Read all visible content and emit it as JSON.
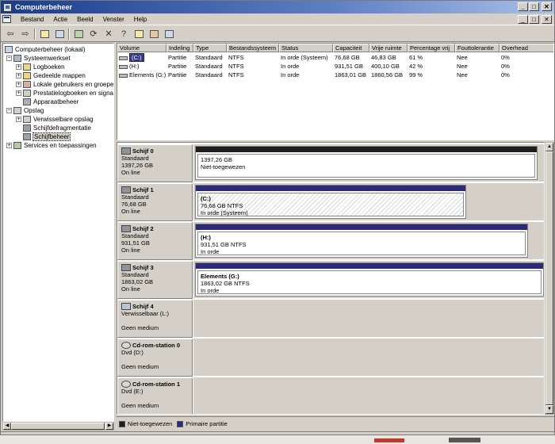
{
  "window": {
    "title": "Computerbeheer",
    "min": "_",
    "max": "□",
    "close": "✕"
  },
  "menu": {
    "items": [
      "Bestand",
      "Actie",
      "Beeld",
      "Venster",
      "Help"
    ]
  },
  "toolbar": {
    "icons": [
      "back-arrow-icon",
      "forward-arrow-icon",
      "up-folder-icon",
      "show-hide-tree-icon",
      "properties-icon",
      "refresh-icon",
      "delete-icon",
      "help-icon",
      "folder-open-icon",
      "search-icon",
      "disk-properties-icon"
    ]
  },
  "tree": {
    "root": "Computerbeheer (lokaal)",
    "systeemwerkset": "Systeemwerkset",
    "logboeken": "Logboeken",
    "gedeelde_mappen": "Gedeelde mappen",
    "lokale_gebruikers": "Lokale gebruikers en groepen",
    "prestatie": "Prestatielogboeken en signalen",
    "apparaatbeheer": "Apparaatbeheer",
    "opslag": "Opslag",
    "verwisselbare": "Verwisselbare opslag",
    "defrag": "Schijfdefragmentatie",
    "schijfbeheer": "Schijfbeheer",
    "services": "Services en toepassingen"
  },
  "volumes": {
    "headers": [
      "Volume",
      "Indeling",
      "Type",
      "Bestandssysteem",
      "Status",
      "Capaciteit",
      "Vrije ruimte",
      "Percentage vrij",
      "Fouttolerantie",
      "Overhead"
    ],
    "rows": [
      {
        "volume": "(C:)",
        "indeling": "Partitie",
        "type": "Standaard",
        "fs": "NTFS",
        "status": "In orde (Systeem)",
        "cap": "76,68 GB",
        "vrij": "46,83 GB",
        "pct": "61 %",
        "fout": "Nee",
        "over": "0%"
      },
      {
        "volume": "(H:)",
        "indeling": "Partitie",
        "type": "Standaard",
        "fs": "NTFS",
        "status": "In orde",
        "cap": "931,51 GB",
        "vrij": "400,10 GB",
        "pct": "42 %",
        "fout": "Nee",
        "over": "0%"
      },
      {
        "volume": "Elements (G:)",
        "indeling": "Partitie",
        "type": "Standaard",
        "fs": "NTFS",
        "status": "In orde",
        "cap": "1863,01 GB",
        "vrij": "1860,56 GB",
        "pct": "99 %",
        "fout": "Nee",
        "over": "0%"
      }
    ]
  },
  "disks": [
    {
      "name": "Schijf 0",
      "type": "Standaard",
      "size": "1397,26 GB",
      "state": "On line",
      "part_title": "",
      "part_size": "1397,26 GB",
      "part_status": "Niet-toegewezen"
    },
    {
      "name": "Schijf 1",
      "type": "Standaard",
      "size": "76,68 GB",
      "state": "On line",
      "part_title": "(C:)",
      "part_size": "76,68 GB NTFS",
      "part_status": "In orde (Systeem)"
    },
    {
      "name": "Schijf 2",
      "type": "Standaard",
      "size": "931,51 GB",
      "state": "On line",
      "part_title": "(H:)",
      "part_size": "931,51 GB NTFS",
      "part_status": "In orde"
    },
    {
      "name": "Schijf 3",
      "type": "Standaard",
      "size": "1863,02 GB",
      "state": "On line",
      "part_title": "Elements  (G:)",
      "part_size": "1863,02 GB NTFS",
      "part_status": "In orde"
    },
    {
      "name": "Schijf 4",
      "type": "Verwisselbaar (L:)",
      "state": "Geen medium"
    },
    {
      "name": "Cd-rom-station 0",
      "type": "Dvd (D:)",
      "state": "Geen medium"
    },
    {
      "name": "Cd-rom-station 1",
      "type": "Dvd (E:)",
      "state": "Geen medium"
    }
  ],
  "legend": {
    "unallocated": "Niet-toegewezen",
    "primary": "Primaire partitie"
  },
  "colors": {
    "unallocated": "#1e1e1e",
    "primary": "#2e2a7a",
    "titlebar": "#1a3b8a"
  }
}
